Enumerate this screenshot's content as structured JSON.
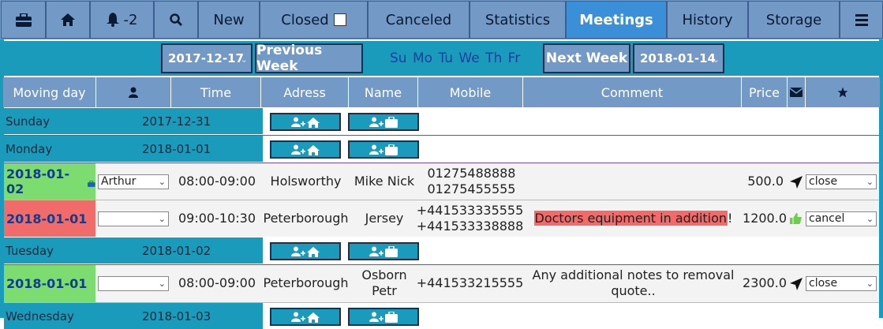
{
  "nav": {
    "alerts_label": "-2",
    "new_label": "New",
    "closed_label": "Closed",
    "canceled_label": "Canceled",
    "statistics_label": "Statistics",
    "meetings_label": "Meetings",
    "history_label": "History",
    "storage_label": "Storage"
  },
  "week": {
    "start_date": "2017-12-17",
    "prev_label": "Previous Week",
    "days": "Su Mo Tu We Th Fr",
    "next_label": "Next Week",
    "end_date": "2018-01-14"
  },
  "table": {
    "headers": {
      "moving_day": "Moving day",
      "time": "Time",
      "adress": "Adress",
      "name": "Name",
      "mobile": "Mobile",
      "comment": "Comment",
      "price": "Price"
    },
    "days": [
      {
        "day": "Sunday",
        "date": "2017-12-31"
      },
      {
        "day": "Monday",
        "date": "2018-01-01"
      },
      {
        "day": "Tuesday",
        "date": "2018-01-02"
      },
      {
        "day": "Wednesday",
        "date": "2018-01-03"
      }
    ],
    "meetings": [
      {
        "date": "2018-01-02",
        "assignee": "Arthur",
        "time": "08:00-09:00",
        "adress": "Holsworthy",
        "name": "Mike Nick",
        "mobile1": "01275488888",
        "mobile2": "01275455555",
        "comment": "",
        "price": "500.0",
        "action": "close"
      },
      {
        "date": "2018-01-01",
        "assignee": "",
        "time": "09:00-10:30",
        "adress": "Peterborough",
        "name": "Jersey",
        "mobile1": "+441533335555",
        "mobile2": "+441533338888",
        "comment": "Doctors equipment in addition",
        "comment_suffix": "!",
        "price": "1200.0",
        "action": "cancel"
      },
      {
        "date": "2018-01-01",
        "assignee": "",
        "time": "08:00-09:00",
        "adress": "Peterborough",
        "name1": "Osborn",
        "name2": "Petr",
        "mobile1": "+441533215555",
        "comment1": "Any additional notes to removal",
        "comment2": "quote..",
        "price": "2300.0",
        "action": "close"
      }
    ]
  },
  "colors": {
    "nav_bg": "#7399c6",
    "nav_active": "#3b8fd9",
    "teal": "#1a9bbb",
    "green_date": "#7ddc70",
    "red_date": "#f26b6b"
  }
}
